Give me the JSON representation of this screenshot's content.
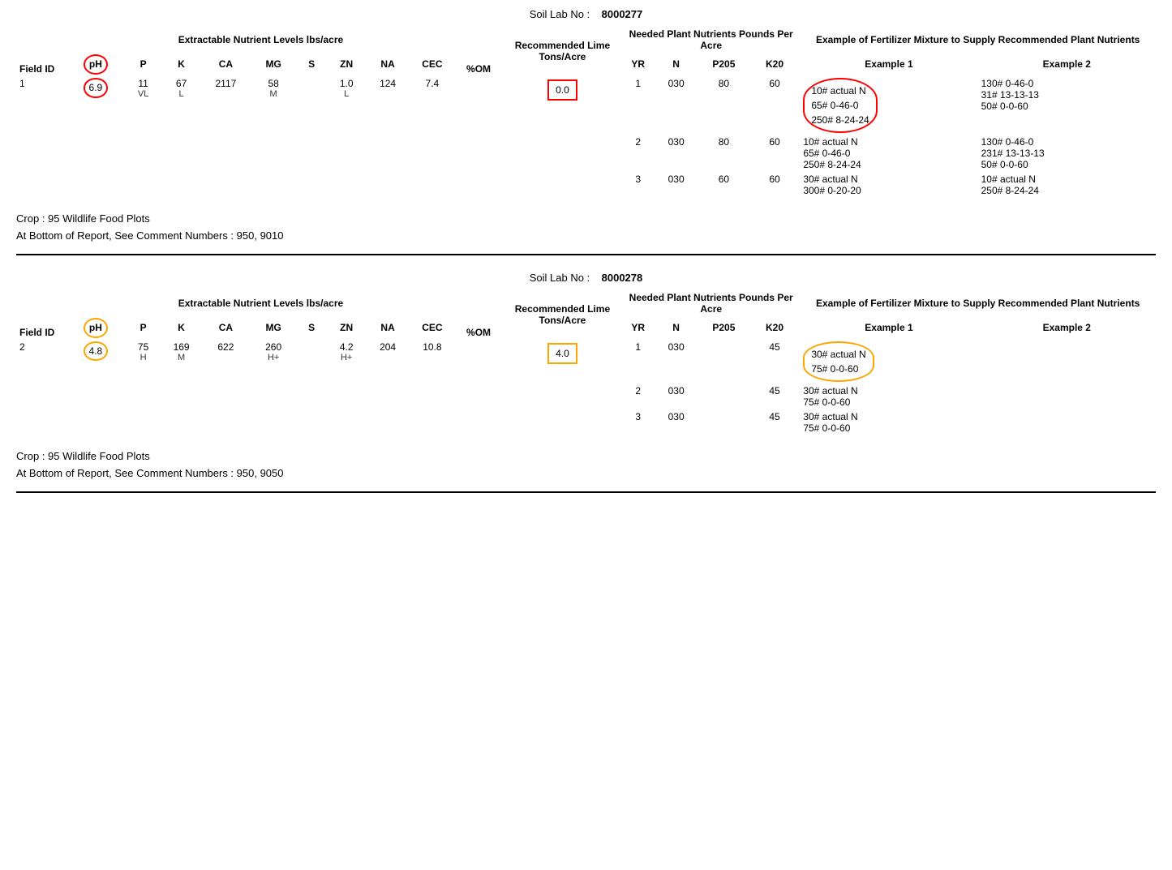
{
  "sections": [
    {
      "soil_lab_label": "Soil Lab No :",
      "soil_lab_no": "8000277",
      "headers": {
        "field_id": "Field ID",
        "extractable": "Extractable Nutrient Levels lbs/acre",
        "ph": "pH",
        "p": "P",
        "k": "K",
        "ca": "CA",
        "mg": "MG",
        "s": "S",
        "zn": "ZN",
        "na": "NA",
        "cec": "CEC",
        "pom": "%OM",
        "lime": "Recommended Lime Tons/Acre",
        "needed": "Needed Plant Nutrients Pounds Per Acre",
        "yr": "YR",
        "n": "N",
        "p205": "P205",
        "k20": "K20",
        "fertilizer": "Example of Fertilizer Mixture to Supply Recommended Plant Nutrients",
        "ex1": "Example 1",
        "ex2": "Example 2"
      },
      "data_row": {
        "field_id": "1",
        "ph": "6.9",
        "p": "11",
        "k": "67",
        "ca": "2117",
        "mg": "58",
        "s": "",
        "zn": "1.0",
        "na": "124",
        "cec": "7.4",
        "pom": "",
        "lime": "0.0",
        "ph_sub": "",
        "p_sub": "VL",
        "k_sub": "L",
        "mg_sub": "M",
        "zn_sub": "L"
      },
      "yr_rows": [
        {
          "yr": "1",
          "n": "030",
          "p205": "80",
          "k20": "60",
          "ex1_lines": [
            "10# actual N",
            "65# 0-46-0",
            "250# 8-24-24"
          ],
          "ex2_lines": [
            "130# 0-46-0",
            "31# 13-13-13",
            "50# 0-0-60"
          ],
          "circle_ex1": true,
          "circle_type": "red"
        },
        {
          "yr": "2",
          "n": "030",
          "p205": "80",
          "k20": "60",
          "ex1_lines": [
            "10# actual N",
            "65# 0-46-0",
            "250# 8-24-24"
          ],
          "ex2_lines": [
            "130# 0-46-0",
            "231# 13-13-13",
            "50# 0-0-60"
          ],
          "circle_ex1": false,
          "circle_type": ""
        },
        {
          "yr": "3",
          "n": "030",
          "p205": "60",
          "k20": "60",
          "ex1_lines": [
            "30# actual N",
            "300# 0-20-20"
          ],
          "ex2_lines": [
            "10# actual N",
            "250# 8-24-24"
          ],
          "circle_ex1": false,
          "circle_type": ""
        }
      ],
      "crop": "Crop :  95    Wildlife Food Plots",
      "comment": "At Bottom of Report, See Comment Numbers :    950, 9010",
      "ph_circle": "red",
      "lime_box": "red",
      "ex1_circle": "red"
    },
    {
      "soil_lab_label": "Soil Lab No :",
      "soil_lab_no": "8000278",
      "headers": {
        "field_id": "Field ID",
        "extractable": "Extractable Nutrient Levels lbs/acre",
        "ph": "pH",
        "p": "P",
        "k": "K",
        "ca": "CA",
        "mg": "MG",
        "s": "S",
        "zn": "ZN",
        "na": "NA",
        "cec": "CEC",
        "pom": "%OM",
        "lime": "Recommended Lime Tons/Acre",
        "needed": "Needed Plant Nutrients Pounds Per Acre",
        "yr": "YR",
        "n": "N",
        "p205": "P205",
        "k20": "K20",
        "fertilizer": "Example of Fertilizer Mixture to Supply Recommended Plant Nutrients",
        "ex1": "Example 1",
        "ex2": "Example 2"
      },
      "data_row": {
        "field_id": "2",
        "ph": "4.8",
        "p": "75",
        "k": "169",
        "ca": "622",
        "mg": "260",
        "s": "",
        "zn": "4.2",
        "na": "204",
        "cec": "10.8",
        "pom": "",
        "lime": "4.0",
        "ph_sub": "",
        "p_sub": "H",
        "k_sub": "M",
        "mg_sub": "",
        "mg_sub2": "H+",
        "zn_sub": "H+"
      },
      "yr_rows": [
        {
          "yr": "1",
          "n": "030",
          "p205": "",
          "k20": "45",
          "ex1_lines": [
            "30# actual N",
            "75# 0-0-60"
          ],
          "ex2_lines": [],
          "circle_ex1": true,
          "circle_type": "orange"
        },
        {
          "yr": "2",
          "n": "030",
          "p205": "",
          "k20": "45",
          "ex1_lines": [
            "30# actual N",
            "75# 0-0-60"
          ],
          "ex2_lines": [],
          "circle_ex1": false,
          "circle_type": ""
        },
        {
          "yr": "3",
          "n": "030",
          "p205": "",
          "k20": "45",
          "ex1_lines": [
            "30# actual N",
            "75# 0-0-60"
          ],
          "ex2_lines": [],
          "circle_ex1": false,
          "circle_type": ""
        }
      ],
      "crop": "Crop :  95    Wildlife Food Plots",
      "comment": "At Bottom of Report, See Comment Numbers :    950, 9050",
      "ph_circle": "orange",
      "lime_box": "orange",
      "ex1_circle": "orange"
    }
  ]
}
